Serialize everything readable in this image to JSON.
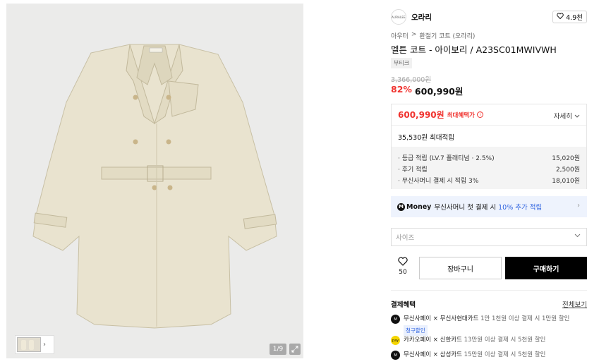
{
  "gallery": {
    "page_counter": "1/9"
  },
  "brand": {
    "logo_text": "AURALEE",
    "name": "오라리",
    "likes": "4.9천"
  },
  "breadcrumb": [
    "아우터",
    ">",
    "환절기 코트 (오라리)"
  ],
  "product": {
    "title": "멜튼 코트 - 아이보리 / A23SC01MWIVWH",
    "tag": "부티크",
    "original_price": "3,366,000원",
    "discount": "82%",
    "price": "600,990원"
  },
  "benefits": {
    "max_price": "600,990원",
    "max_benefit_label": "최대혜택가",
    "detail_toggle": "자세히",
    "points_total": "35,530원 최대적립",
    "points": [
      {
        "label": "· 등급 적립 (LV.7 플래티넘 · 2.5%)",
        "value": "15,020원"
      },
      {
        "label": "· 후기 적립",
        "value": "2,500원"
      },
      {
        "label": "· 무신사머니 결제 시 적립 3%",
        "value": "18,010원"
      }
    ]
  },
  "money_banner": {
    "logo": "Money",
    "text": "무신사머니 첫 결제 시",
    "highlight": "10% 추가 적립"
  },
  "size_select": {
    "placeholder": "사이즈"
  },
  "actions": {
    "wish_count": "50",
    "cart_label": "장바구니",
    "buy_label": "구매하기"
  },
  "payment": {
    "title": "결제혜택",
    "view_all": "전체보기",
    "items": [
      {
        "name": "무신사페이 × 무신사현대카드",
        "detail": "1만 1천원 이상 결제 시 1만원 할인",
        "badge": "청구할인",
        "color": "#111111"
      },
      {
        "name": "카카오페이 × 신한카드",
        "detail": "13만원 이상 결제 시 5천원 할인",
        "color": "#f5d600"
      },
      {
        "name": "무신사페이 × 삼성카드",
        "detail": "15만원 이상 결제 시 5천원 할인",
        "color": "#111111"
      }
    ]
  }
}
